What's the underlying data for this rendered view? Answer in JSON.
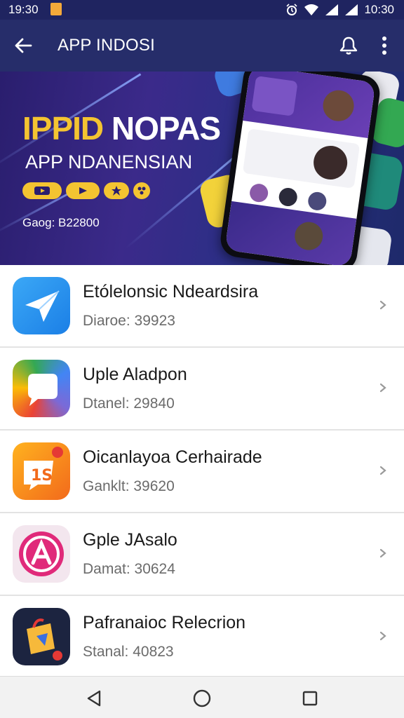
{
  "status_bar": {
    "time_left": "19:30",
    "time_right": "10:30"
  },
  "app_bar": {
    "title": "APP INDOSI"
  },
  "banner": {
    "title_highlight": "IPPID",
    "title_rest": " NOPAS",
    "subtitle": "APP NDANENSIAN",
    "caption": "Gaog: B22800"
  },
  "apps": [
    {
      "name": "Etólelonsic Ndeardsira",
      "meta": "Diaroe: 39923",
      "icon": "paper-plane-icon"
    },
    {
      "name": "Uple Aladpon",
      "meta": "Dtanel: 29840",
      "icon": "chat-bubble-icon"
    },
    {
      "name": "Oicanlayoa Cerhairade",
      "meta": "Ganklt: 39620",
      "icon": "dis-logo-icon"
    },
    {
      "name": "Gple JAsalo",
      "meta": "Damat: 30624",
      "icon": "letter-a-icon"
    },
    {
      "name": "Pafranaioc Relecrion",
      "meta": "Stanal: 40823",
      "icon": "shopping-bag-icon"
    }
  ],
  "colors": {
    "status_bar": "#1f2460",
    "app_bar": "#262d6a",
    "accent": "#f4c431"
  },
  "nav": {
    "back": "back-triangle-icon",
    "home": "home-circle-icon",
    "recents": "recents-square-icon"
  }
}
